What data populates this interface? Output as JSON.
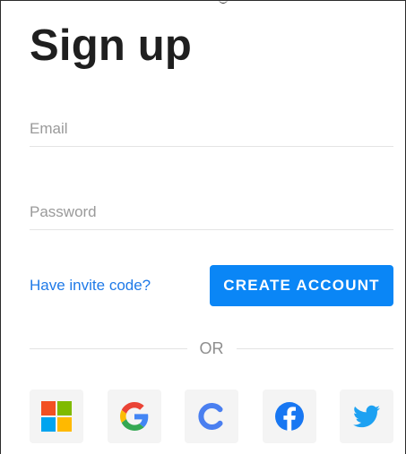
{
  "page": {
    "title": "Sign up"
  },
  "form": {
    "email": {
      "placeholder": "Email",
      "value": ""
    },
    "password": {
      "placeholder": "Password",
      "value": ""
    }
  },
  "actions": {
    "invite_link_label": "Have invite code?",
    "create_account_label": "CREATE ACCOUNT"
  },
  "divider": {
    "or_label": "OR"
  },
  "social": {
    "providers": [
      {
        "name": "Microsoft",
        "icon": "microsoft-icon"
      },
      {
        "name": "Google",
        "icon": "google-icon"
      },
      {
        "name": "C",
        "icon": "c-logo-icon"
      },
      {
        "name": "Facebook",
        "icon": "facebook-icon"
      },
      {
        "name": "Twitter",
        "icon": "twitter-icon"
      }
    ]
  },
  "colors": {
    "accent": "#0a86f6",
    "link": "#1f7ae8",
    "title": "#1f1f1f",
    "placeholder": "#9a9a9a"
  }
}
